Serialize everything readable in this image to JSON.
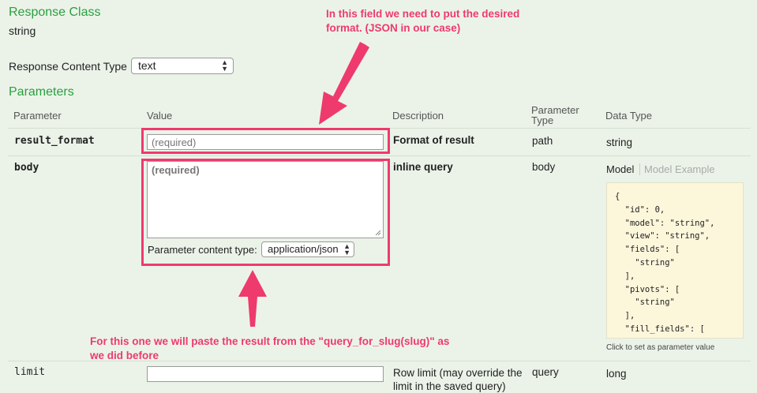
{
  "response_class": {
    "heading": "Response Class",
    "value": "string"
  },
  "content_type": {
    "label": "Response Content Type",
    "selected": "text"
  },
  "parameters": {
    "heading": "Parameters",
    "headers": {
      "parameter": "Parameter",
      "value": "Value",
      "description": "Description",
      "parameter_type_1": "Parameter",
      "parameter_type_2": "Type",
      "data_type": "Data Type"
    },
    "rows": [
      {
        "name": "result_format",
        "placeholder": "(required)",
        "description": "Format of result",
        "param_type": "path",
        "data_type": "string"
      },
      {
        "name": "body",
        "placeholder": "(required)",
        "description": "inline query",
        "param_type": "body",
        "content_type_label": "Parameter content type:",
        "content_type_selected": "application/json"
      },
      {
        "name": "limit",
        "placeholder": "",
        "description_1": "Row limit (may override the",
        "description_2": "limit in the saved query)",
        "param_type": "query",
        "data_type": "long"
      }
    ]
  },
  "model_tabs": {
    "model": "Model",
    "model_example": "Model Example"
  },
  "model_code": "{\n  \"id\": 0,\n  \"model\": \"string\",\n  \"view\": \"string\",\n  \"fields\": [\n    \"string\"\n  ],\n  \"pivots\": [\n    \"string\"\n  ],\n  \"fill_fields\": [",
  "model_hint": "Click to set as parameter value",
  "annotations": {
    "top_1": "In this field we need to put the desired",
    "top_2": "format. (JSON in our case)",
    "bottom_1": "For this one we will paste the result from the \"query_for_slug(slug)\" as",
    "bottom_2": "we did before"
  },
  "colors": {
    "heading_green": "#2b9f3f",
    "annotation_pink": "#ee3a6c",
    "background": "#ebf3e9"
  }
}
